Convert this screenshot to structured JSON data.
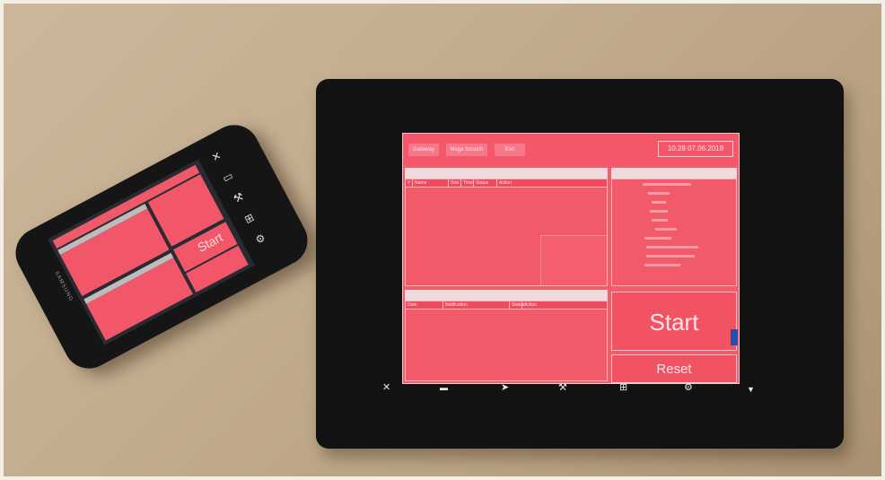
{
  "phone": {
    "start_label": "Start",
    "brand": "SAMSUNG",
    "nav_icons": [
      "close-icon",
      "keyboard-icon",
      "wrench-icon",
      "windows-icon",
      "gear-icon"
    ]
  },
  "tablet": {
    "menu": [
      "Gateway",
      "Mega Scratch",
      "Exit"
    ],
    "clock": "10:28 07.06.2018",
    "panel_left_top_title": "",
    "table1_headers": [
      "#",
      "Name",
      "Stat",
      "Time",
      "Status",
      "Action"
    ],
    "panel_left_bottom_title": "",
    "table2_headers": [
      "Date",
      "Notification",
      "Status",
      "Action"
    ],
    "panel_right_title": "",
    "start_label": "Start",
    "reset_label": "Reset",
    "nav_icons": [
      "close-icon",
      "keyboard-icon",
      "cursor-icon",
      "wrench-icon",
      "windows-icon",
      "gear-icon",
      "dropdown-icon"
    ],
    "colors": {
      "accent": "#f25c6b",
      "bezel": "#121212"
    }
  }
}
